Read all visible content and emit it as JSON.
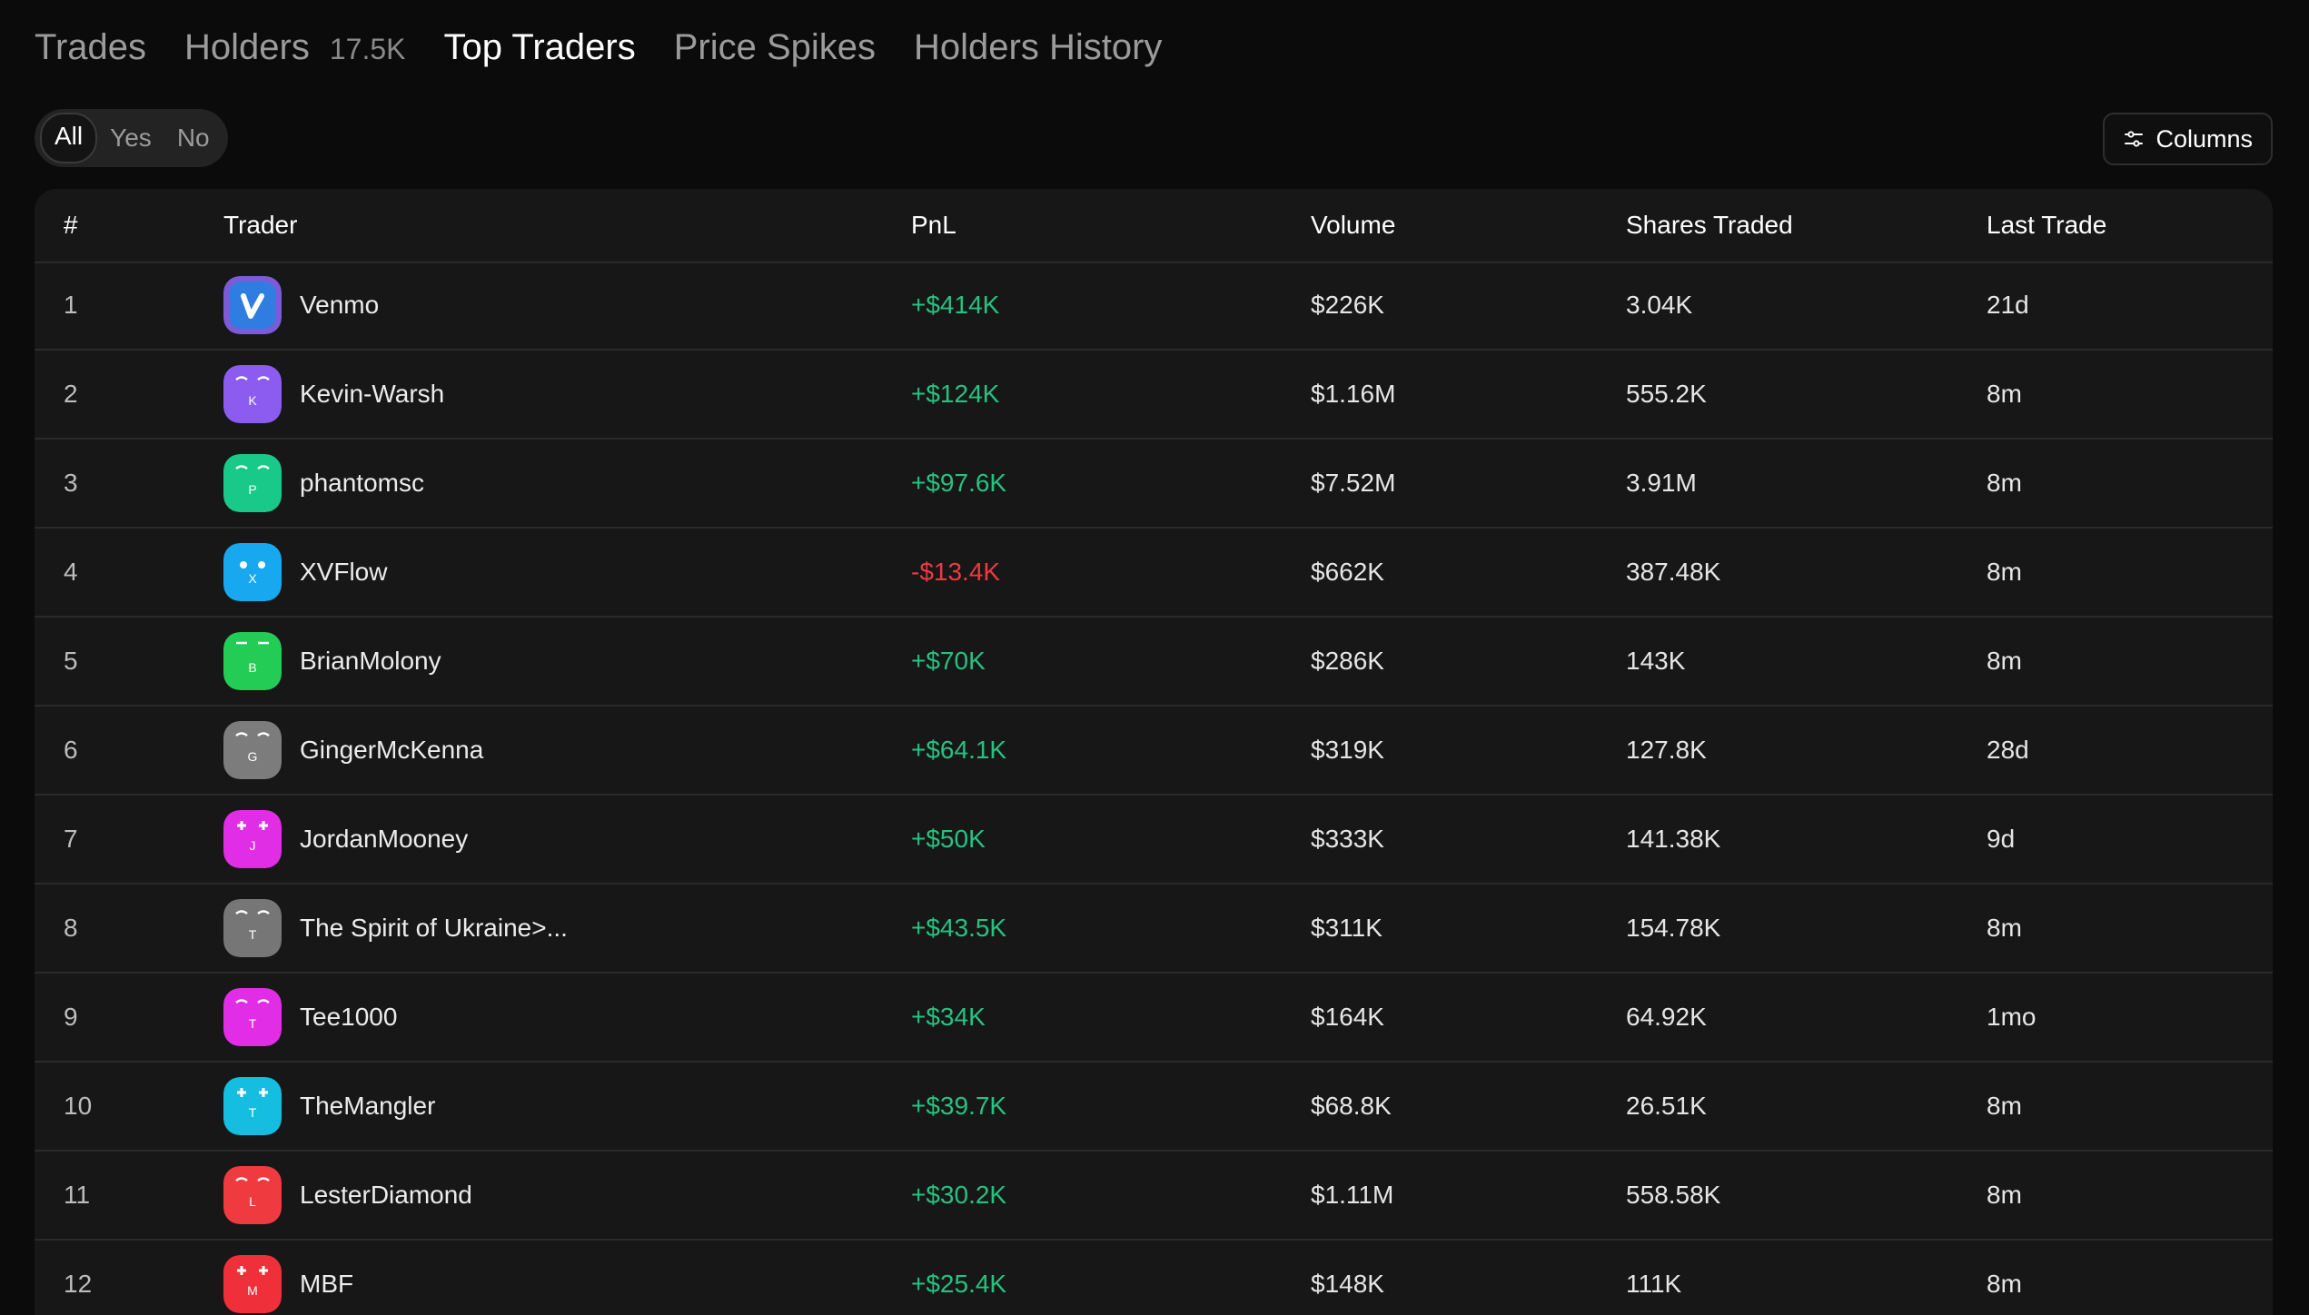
{
  "tabs": [
    {
      "label": "Trades",
      "active": false
    },
    {
      "label": "Holders",
      "count": "17.5K",
      "active": false
    },
    {
      "label": "Top Traders",
      "active": true
    },
    {
      "label": "Price Spikes",
      "active": false
    },
    {
      "label": "Holders History",
      "active": false
    }
  ],
  "filter": {
    "options": [
      "All",
      "Yes",
      "No"
    ],
    "selected": "All"
  },
  "columns_button": {
    "label": "Columns",
    "icon": "sliders-icon"
  },
  "table": {
    "headers": [
      "#",
      "Trader",
      "PnL",
      "Volume",
      "Shares Traded",
      "Last Trade"
    ],
    "rows": [
      {
        "rank": "1",
        "trader": "Venmo",
        "pnl": "+$414K",
        "volume": "$226K",
        "shares": "3.04K",
        "last": "21d"
      },
      {
        "rank": "2",
        "trader": "Kevin-Warsh",
        "pnl": "+$124K",
        "volume": "$1.16M",
        "shares": "555.2K",
        "last": "8m"
      },
      {
        "rank": "3",
        "trader": "phantomsc",
        "pnl": "+$97.6K",
        "volume": "$7.52M",
        "shares": "3.91M",
        "last": "8m"
      },
      {
        "rank": "4",
        "trader": "XVFlow",
        "pnl": "-$13.4K",
        "volume": "$662K",
        "shares": "387.48K",
        "last": "8m"
      },
      {
        "rank": "5",
        "trader": "BrianMolony",
        "pnl": "+$70K",
        "volume": "$286K",
        "shares": "143K",
        "last": "8m"
      },
      {
        "rank": "6",
        "trader": "GingerMcKenna",
        "pnl": "+$64.1K",
        "volume": "$319K",
        "shares": "127.8K",
        "last": "28d"
      },
      {
        "rank": "7",
        "trader": "JordanMooney",
        "pnl": "+$50K",
        "volume": "$333K",
        "shares": "141.38K",
        "last": "9d"
      },
      {
        "rank": "8",
        "trader": "The Spirit of Ukraine>...",
        "pnl": "+$43.5K",
        "volume": "$311K",
        "shares": "154.78K",
        "last": "8m"
      },
      {
        "rank": "9",
        "trader": "Tee1000",
        "pnl": "+$34K",
        "volume": "$164K",
        "shares": "64.92K",
        "last": "1mo"
      },
      {
        "rank": "10",
        "trader": "TheMangler",
        "pnl": "+$39.7K",
        "volume": "$68.8K",
        "shares": "26.51K",
        "last": "8m"
      },
      {
        "rank": "11",
        "trader": "LesterDiamond",
        "pnl": "+$30.2K",
        "volume": "$1.11M",
        "shares": "558.58K",
        "last": "8m"
      },
      {
        "rank": "12",
        "trader": "MBF",
        "pnl": "+$25.4K",
        "volume": "$148K",
        "shares": "111K",
        "last": "8m"
      }
    ],
    "avatars": [
      {
        "letter": "v",
        "color": "#2f7de0",
        "accent": "#7b5cd6",
        "style": "venmo"
      },
      {
        "letter": "K",
        "color": "#8c5cf0",
        "style": "smile"
      },
      {
        "letter": "P",
        "color": "#19c98a",
        "style": "smile"
      },
      {
        "letter": "X",
        "color": "#18a8f0",
        "style": "dots"
      },
      {
        "letter": "B",
        "color": "#22cc55",
        "style": "brows"
      },
      {
        "letter": "G",
        "color": "#7c7c7c",
        "style": "smile"
      },
      {
        "letter": "J",
        "color": "#e22de6",
        "style": "sparkle"
      },
      {
        "letter": "T",
        "color": "#767676",
        "style": "smile"
      },
      {
        "letter": "T",
        "color": "#e22de6",
        "style": "smile"
      },
      {
        "letter": "T",
        "color": "#15bde0",
        "style": "sparkle"
      },
      {
        "letter": "L",
        "color": "#ef3b3f",
        "style": "smile"
      },
      {
        "letter": "M",
        "color": "#ef2f3a",
        "style": "sparkle"
      }
    ]
  }
}
